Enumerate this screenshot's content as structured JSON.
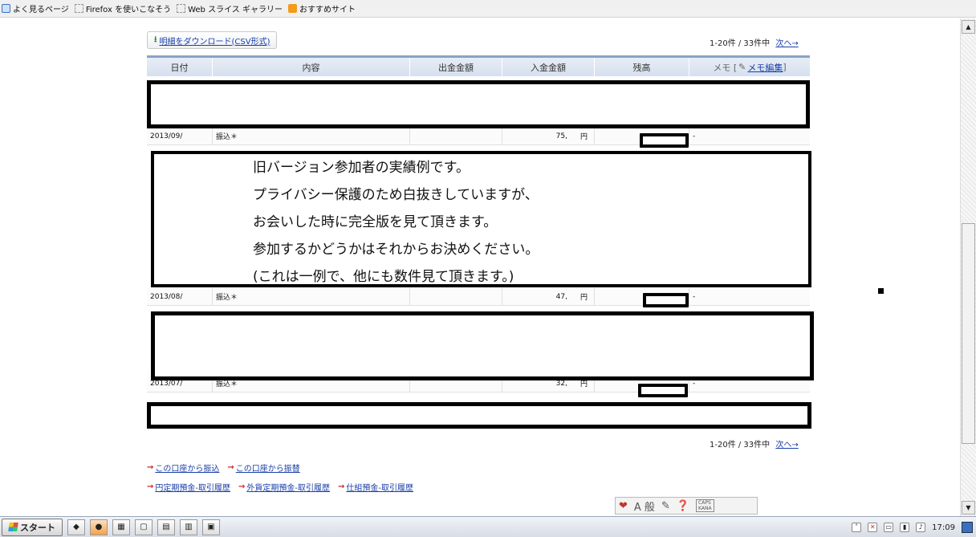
{
  "bookmarks": [
    {
      "label": "よく見るページ",
      "icon": "blue-page-icon"
    },
    {
      "label": "Firefox を使いこなそう",
      "icon": "dashed-page-icon"
    },
    {
      "label": "Web スライス ギャラリー",
      "icon": "dashed-page-icon"
    },
    {
      "label": "おすすめサイト",
      "icon": "orange-icon"
    }
  ],
  "download": {
    "label": "明細をダウンロード(CSV形式)"
  },
  "pagination": {
    "count": "1-20件 / 33件中",
    "next": "次へ→"
  },
  "table": {
    "headers": {
      "date": "日付",
      "desc": "内容",
      "withdraw": "出金金額",
      "deposit": "入金金額",
      "balance": "残高",
      "memo_prefix": "メモ [",
      "memo_link": "メモ編集",
      "memo_suffix": "]"
    },
    "rows": [
      {
        "date": "2013/09/",
        "desc": "振込＊",
        "deposit": "75,",
        "yen": "円",
        "memo": "-"
      },
      {
        "date": "2013/08/",
        "desc": "振込＊",
        "deposit": "47,",
        "yen": "円",
        "memo": "-"
      },
      {
        "date": "2013/07/",
        "desc": "振込＊",
        "deposit": "32,",
        "yen": "円",
        "memo": "-"
      }
    ]
  },
  "notice": {
    "lines": [
      "旧バージョン参加者の実績例です。",
      "プライバシー保護のため白抜きしていますが、",
      "お会いした時に完全版を見て頂きます。",
      "参加するかどうかはそれからお決めください。",
      "(これは一例で、他にも数件見て頂きます。)"
    ]
  },
  "links": {
    "row1": [
      "この口座から振込",
      "この口座から振替"
    ],
    "row2": [
      "円定期預金-取引履歴",
      "外貨定期預金-取引履歴",
      "仕組預金-取引履歴"
    ]
  },
  "ime": {
    "label": "A 般",
    "caps": "CAPS",
    "kana": "KANA"
  },
  "taskbar": {
    "start": "スタート",
    "clock": "17:09"
  }
}
